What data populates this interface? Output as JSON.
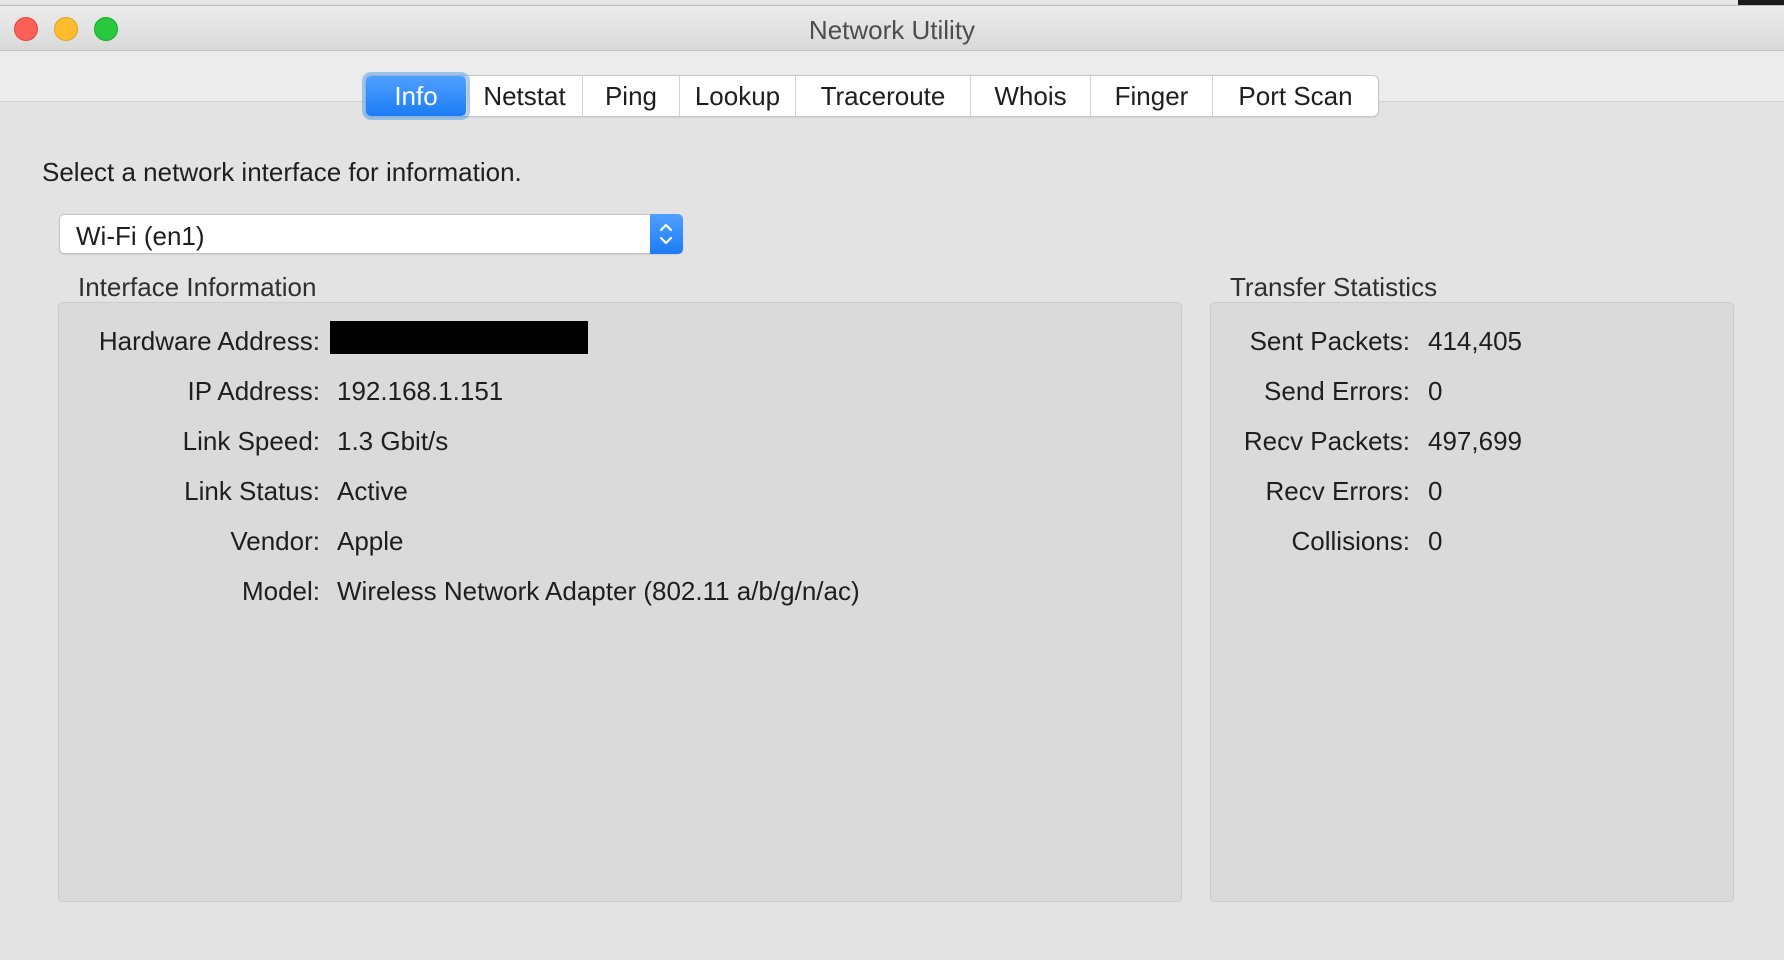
{
  "window": {
    "title": "Network Utility"
  },
  "tabs": [
    {
      "label": "Info",
      "active": true
    },
    {
      "label": "Netstat",
      "active": false
    },
    {
      "label": "Ping",
      "active": false
    },
    {
      "label": "Lookup",
      "active": false
    },
    {
      "label": "Traceroute",
      "active": false
    },
    {
      "label": "Whois",
      "active": false
    },
    {
      "label": "Finger",
      "active": false
    },
    {
      "label": "Port Scan",
      "active": false
    }
  ],
  "info": {
    "prompt": "Select a network interface for information.",
    "interface_selected": "Wi-Fi (en1)",
    "interface_group_title": "Interface Information",
    "interface_rows": [
      {
        "label": "Hardware Address:",
        "value": ""
      },
      {
        "label": "IP Address:",
        "value": "192.168.1.151"
      },
      {
        "label": "Link Speed:",
        "value": "1.3 Gbit/s"
      },
      {
        "label": "Link Status:",
        "value": "Active"
      },
      {
        "label": "Vendor:",
        "value": "Apple"
      },
      {
        "label": "Model:",
        "value": "Wireless Network Adapter (802.11 a/b/g/n/ac)"
      }
    ],
    "stats_group_title": "Transfer Statistics",
    "stats_rows": [
      {
        "label": "Sent Packets:",
        "value": "414,405"
      },
      {
        "label": "Send Errors:",
        "value": "0"
      },
      {
        "label": "Recv Packets:",
        "value": "497,699"
      },
      {
        "label": "Recv Errors:",
        "value": "0"
      },
      {
        "label": "Collisions:",
        "value": "0"
      }
    ]
  },
  "icons": {
    "close": "close-window-icon",
    "minimize": "minimize-window-icon",
    "maximize": "maximize-window-icon",
    "stepper": "chevron-up-down-icon"
  },
  "colors": {
    "accent": "#1c7cf4",
    "close": "#fe5f57",
    "minimize": "#febc2e",
    "maximize": "#28c840",
    "panel": "#dadada",
    "window": "#e3e3e3"
  }
}
